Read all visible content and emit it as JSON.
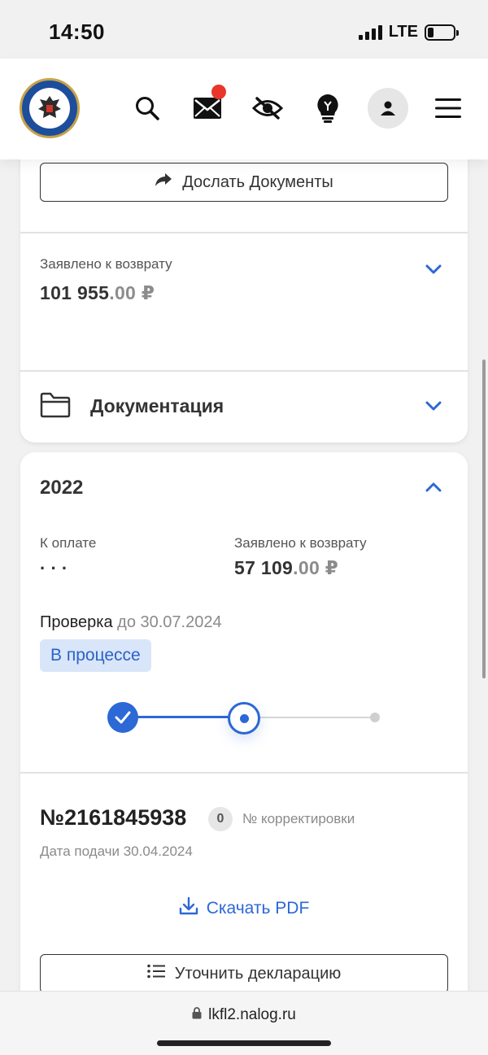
{
  "status_bar": {
    "time": "14:50",
    "network": "LTE",
    "battery_level": 0.22
  },
  "header": {
    "icons": [
      "search-icon",
      "mail-icon",
      "hidden-eye-icon",
      "lightbulb-icon",
      "profile-icon",
      "menu-icon"
    ],
    "mail_unread": true,
    "accent_color": "#e8362a"
  },
  "card1": {
    "send_docs_label": "Дослать Документы",
    "claimed_refund_label": "Заявлено к возврату",
    "claimed_refund_main": "101 955",
    "claimed_refund_kop": ".00 ₽",
    "documentation_label": "Документация"
  },
  "card2": {
    "year": "2022",
    "to_pay_label": "К оплате",
    "to_pay_value": "· · ·",
    "claimed_refund_label": "Заявлено к возврату",
    "claimed_refund_main": "57 109",
    "claimed_refund_kop": ".00 ₽",
    "check_label": "Проверка",
    "check_deadline": "до 30.07.2024",
    "status": "В процессе",
    "progress_steps": 3,
    "progress_current_step": 2,
    "declaration_number": "№2161845938",
    "correction_count": "0",
    "correction_label": "№ корректировки",
    "submission_date": "Дата подачи 30.04.2024",
    "download_pdf_label": "Скачать PDF",
    "clarify_label": "Уточнить декларацию"
  },
  "browser": {
    "url": "lkfl2.nalog.ru"
  },
  "colors": {
    "primary_blue": "#2c68d6",
    "badge_bg": "#d9e5f9"
  }
}
